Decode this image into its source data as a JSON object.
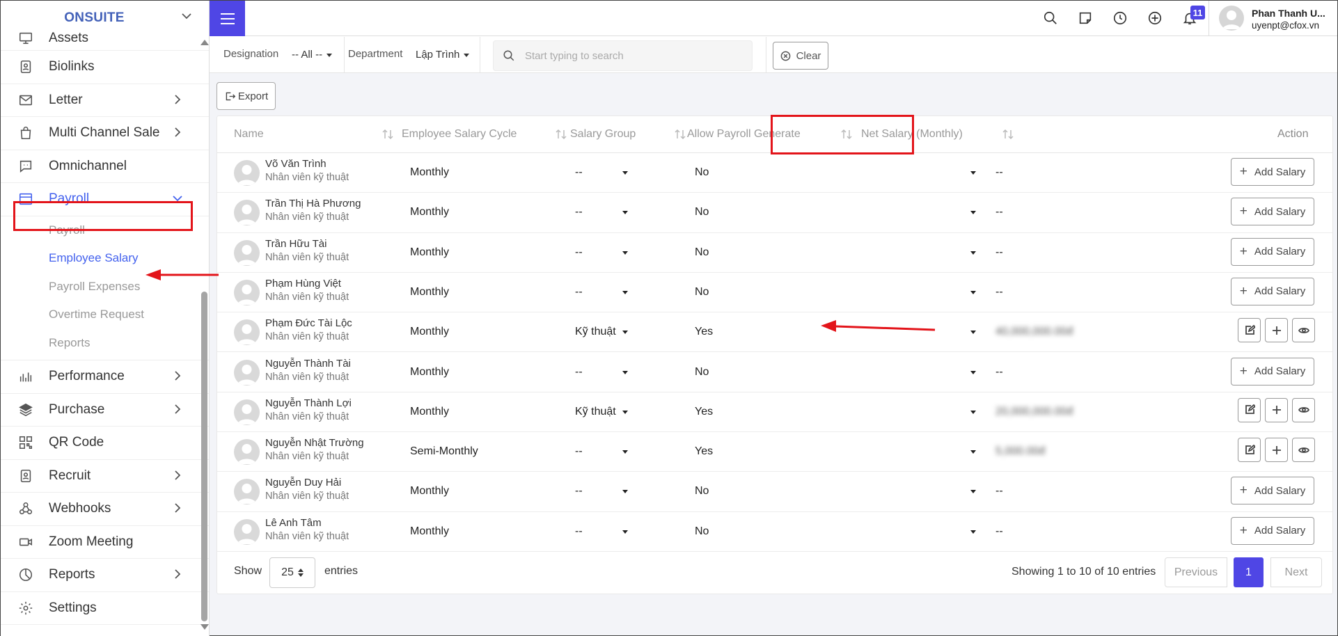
{
  "sidebar": {
    "brand": "ONSUITE",
    "items": [
      {
        "label": "Assets"
      },
      {
        "label": "Biolinks"
      },
      {
        "label": "Letter"
      },
      {
        "label": "Multi Channel Sale"
      },
      {
        "label": "Omnichannel"
      },
      {
        "label": "Payroll"
      },
      {
        "label": "Performance"
      },
      {
        "label": "Purchase"
      },
      {
        "label": "QR Code"
      },
      {
        "label": "Recruit"
      },
      {
        "label": "Webhooks"
      },
      {
        "label": "Zoom Meeting"
      },
      {
        "label": "Reports"
      },
      {
        "label": "Settings"
      }
    ],
    "payroll_sub": [
      {
        "label": "Payroll"
      },
      {
        "label": "Employee Salary"
      },
      {
        "label": "Payroll Expenses"
      },
      {
        "label": "Overtime Request"
      },
      {
        "label": "Reports"
      }
    ]
  },
  "topbar": {
    "notification_count": "11",
    "user_name": "Phan Thanh U...",
    "user_email": "uyenpt@cfox.vn"
  },
  "filters": {
    "designation_label": "Designation",
    "designation_value": "-- All --",
    "department_label": "Department",
    "department_value": "Lập Trình",
    "search_placeholder": "Start typing to search",
    "clear_label": "Clear"
  },
  "toolbar": {
    "export_label": "Export"
  },
  "table": {
    "headers": {
      "name": "Name",
      "cycle": "Employee Salary Cycle",
      "group": "Salary Group",
      "allow": "Allow Payroll Generate",
      "net": "Net Salary (Monthly)",
      "action": "Action"
    },
    "add_salary_label": "Add Salary",
    "rows": [
      {
        "name": "Võ Văn Trình",
        "role": "Nhân viên kỹ thuật",
        "cycle": "Monthly",
        "group": "--",
        "allow": "No",
        "net": "--",
        "has_salary": false
      },
      {
        "name": "Trần Thị Hà Phương",
        "role": "Nhân viên kỹ thuật",
        "cycle": "Monthly",
        "group": "--",
        "allow": "No",
        "net": "--",
        "has_salary": false
      },
      {
        "name": "Trần Hữu Tài",
        "role": "Nhân viên kỹ thuật",
        "cycle": "Monthly",
        "group": "--",
        "allow": "No",
        "net": "--",
        "has_salary": false
      },
      {
        "name": "Phạm Hùng Việt",
        "role": "Nhân viên kỹ thuật",
        "cycle": "Monthly",
        "group": "--",
        "allow": "No",
        "net": "--",
        "has_salary": false
      },
      {
        "name": "Phạm Đức Tài Lộc",
        "role": "Nhân viên kỹ thuật",
        "cycle": "Monthly",
        "group": "Kỹ thuật",
        "allow": "Yes",
        "net": "40,000,000.00đ",
        "has_salary": true
      },
      {
        "name": "Nguyễn Thành Tài",
        "role": "Nhân viên kỹ thuật",
        "cycle": "Monthly",
        "group": "--",
        "allow": "No",
        "net": "--",
        "has_salary": false
      },
      {
        "name": "Nguyễn Thành Lợi",
        "role": "Nhân viên kỹ thuật",
        "cycle": "Monthly",
        "group": "Kỹ thuật",
        "allow": "Yes",
        "net": "20,000,000.00đ",
        "has_salary": true
      },
      {
        "name": "Nguyễn Nhật Trường",
        "role": "Nhân viên kỹ thuật",
        "cycle": "Semi-Monthly",
        "group": "--",
        "allow": "Yes",
        "net": "5,000.00đ",
        "has_salary": true
      },
      {
        "name": "Nguyễn Duy Hải",
        "role": "Nhân viên kỹ thuật",
        "cycle": "Monthly",
        "group": "--",
        "allow": "No",
        "net": "--",
        "has_salary": false
      },
      {
        "name": "Lê Anh Tâm",
        "role": "Nhân viên kỹ thuật",
        "cycle": "Monthly",
        "group": "--",
        "allow": "No",
        "net": "--",
        "has_salary": false
      }
    ]
  },
  "footer": {
    "show_label": "Show",
    "page_size": "25",
    "entries_label": "entries",
    "showing_text": "Showing 1 to 10 of 10 entries",
    "prev_label": "Previous",
    "current_page": "1",
    "next_label": "Next"
  },
  "colors": {
    "accent": "#4f46e5",
    "brand": "#4361b8",
    "annotation": "#e3141a"
  }
}
